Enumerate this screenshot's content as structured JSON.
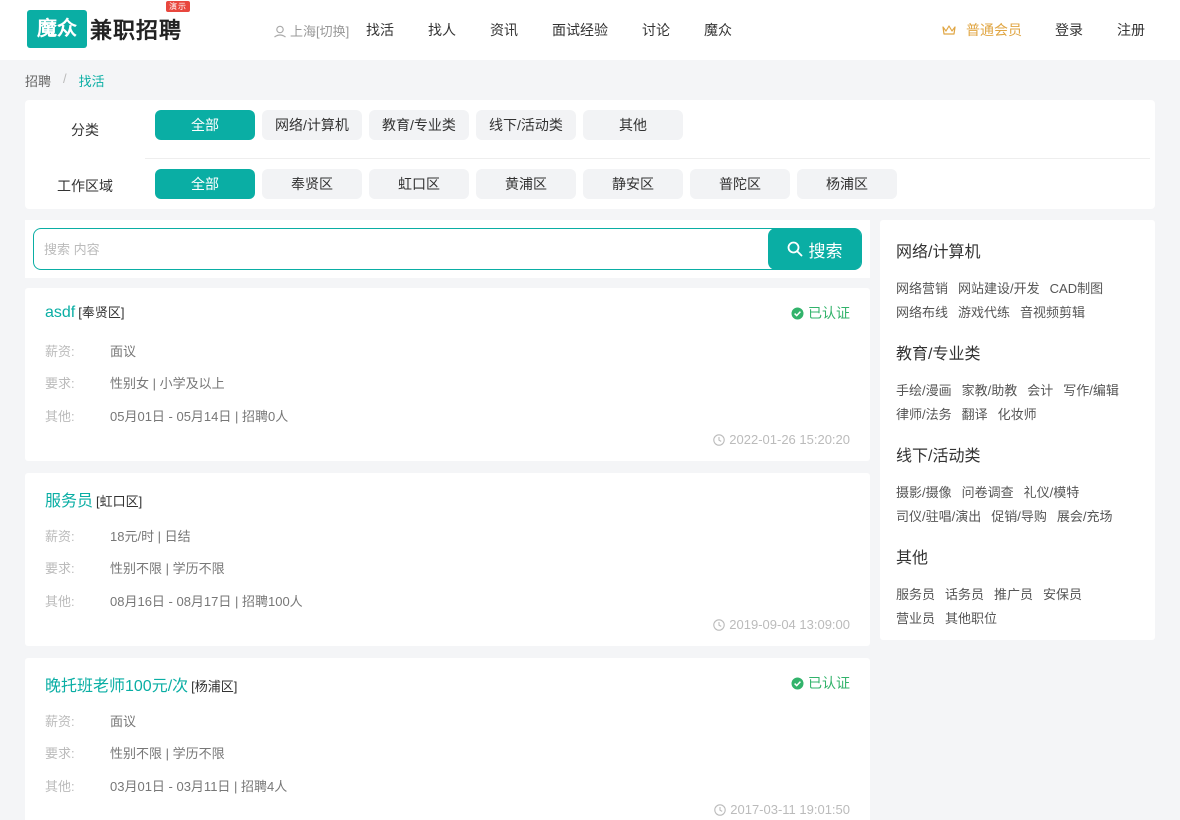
{
  "header": {
    "logo_box": "魔众",
    "logo_text": "兼职招聘",
    "logo_badge": "演示",
    "city": "上海[切换]",
    "nav": [
      "找活",
      "找人",
      "资讯",
      "面试经验",
      "讨论",
      "魔众"
    ],
    "vip": "普通会员",
    "login": "登录",
    "register": "注册"
  },
  "breadcrumb": {
    "home": "招聘",
    "sep": "/",
    "current": "找活"
  },
  "filter": {
    "category_label": "分类",
    "categories": [
      "全部",
      "网络/计算机",
      "教育/专业类",
      "线下/活动类",
      "其他"
    ],
    "area_label": "工作区域",
    "areas": [
      "全部",
      "奉贤区",
      "虹口区",
      "黄浦区",
      "静安区",
      "普陀区",
      "杨浦区"
    ]
  },
  "search": {
    "placeholder": "搜索 内容",
    "button": "搜索"
  },
  "jobs": [
    {
      "title": "asdf",
      "area": "[奉贤区]",
      "verified": "已认证",
      "salary_label": "薪资:",
      "salary": "面议",
      "req_label": "要求:",
      "req": "性别女 | 小学及以上",
      "other_label": "其他:",
      "other": "05月01日 - 05月14日 | 招聘0人",
      "time": "2022-01-26 15:20:20"
    },
    {
      "title": "服务员",
      "area": "[虹口区]",
      "verified": "",
      "salary_label": "薪资:",
      "salary": "18元/时 | 日结",
      "req_label": "要求:",
      "req": "性别不限 | 学历不限",
      "other_label": "其他:",
      "other": "08月16日 - 08月17日 | 招聘100人",
      "time": "2019-09-04 13:09:00"
    },
    {
      "title": "晚托班老师100元/次",
      "area": "[杨浦区]",
      "verified": "已认证",
      "salary_label": "薪资:",
      "salary": "面议",
      "req_label": "要求:",
      "req": "性别不限 | 学历不限",
      "other_label": "其他:",
      "other": "03月01日 - 03月11日 | 招聘4人",
      "time": "2017-03-11 19:01:50"
    }
  ],
  "sidebar": [
    {
      "title": "网络/计算机",
      "tags": [
        "网络营销",
        "网站建设/开发",
        "CAD制图",
        "网络布线",
        "游戏代练",
        "音视频剪辑"
      ]
    },
    {
      "title": "教育/专业类",
      "tags": [
        "手绘/漫画",
        "家教/助教",
        "会计",
        "写作/编辑",
        "律师/法务",
        "翻译",
        "化妆师"
      ]
    },
    {
      "title": "线下/活动类",
      "tags": [
        "摄影/摄像",
        "问卷调查",
        "礼仪/模特",
        "司仪/驻唱/演出",
        "促销/导购",
        "展会/充场"
      ]
    },
    {
      "title": "其他",
      "tags": [
        "服务员",
        "话务员",
        "推广员",
        "安保员",
        "营业员",
        "其他职位"
      ]
    }
  ],
  "colors": {
    "accent": "#0aaea4",
    "verified": "#32b36b",
    "vip": "#e0a644"
  }
}
